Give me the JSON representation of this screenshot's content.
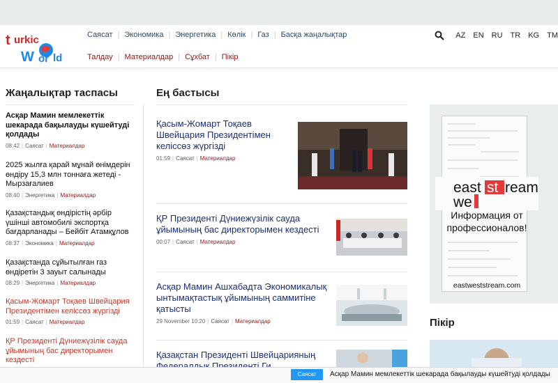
{
  "logo": {
    "text": "turkic world"
  },
  "nav_primary": [
    "Саясат",
    "Экономика",
    "Энергетика",
    "Көлік",
    "Газ",
    "Басқа жаңалықтар"
  ],
  "nav_secondary": [
    "Талдау",
    "Материалдар",
    "Сұхбат",
    "Пікір"
  ],
  "languages": [
    "AZ",
    "EN",
    "RU",
    "TR",
    "KG",
    "TM"
  ],
  "feed": {
    "title": "Жаңалықтар таспасы",
    "items": [
      {
        "title": "Асқар Мамин мемлекеттік шекарада бақылауды күшейтуді қолдады",
        "time": "08:42",
        "category": "Саясат",
        "type": "Материалдар"
      },
      {
        "title": "2025 жылға қарай мұнай өнімдерін өндіру 15,3 млн тоннаға жетеді - Мырзағалиев",
        "time": "08:40",
        "category": "Энергетика",
        "type": "Материалдар"
      },
      {
        "title": "Қазақстандық өндірістің әрбір үшінші автомобилі экспортқа бағдарланады – Бейбіт Атамқұлов",
        "time": "08:37",
        "category": "Экономика",
        "type": "Материалдар"
      },
      {
        "title": "Қазақстанда сұйытылған газ өндіретін 3 зауыт салынады",
        "time": "08:29",
        "category": "Энергетика",
        "type": "Материалдар"
      },
      {
        "title": "Қасым-Жомарт Тоқаев Швейцария Президентімен келіссөз жүргізді",
        "time": "01:59",
        "category": "Саясат",
        "type": "Материалдар"
      },
      {
        "title": "ҚР Президенті Дүниежүзілік сауда ұйымының бас директорымен кездесті",
        "time": "",
        "category": "",
        "type": ""
      }
    ]
  },
  "top": {
    "title": "Ең бастысы",
    "stories": [
      {
        "title": "Қасым-Жомарт Тоқаев Швейцария Президентімен келіссөз жүргізді",
        "time": "01:59",
        "category": "Саясат",
        "type": "Материалдар"
      },
      {
        "title": "ҚР Президенті Дүниежүзілік сауда ұйымының бас директорымен кездесті",
        "time": "00:07",
        "category": "Саясат",
        "type": "Материалдар"
      },
      {
        "title": "Асқар Мамин Ашхабадта Экономикалық ынтымақтастық ұйымының саммитіне қатысты",
        "time": "29 November 10:20",
        "category": "Саясат",
        "type": "Материалдар"
      },
      {
        "title": "Қазақстан Президенті Швейцарияның Федералдық Президенті Ги",
        "time": "",
        "category": "",
        "type": ""
      }
    ]
  },
  "ad": {
    "brand_top": "east",
    "brand_mid": "st",
    "brand_bottom_left": "we",
    "brand_bottom_right": "ream",
    "text": "Информация от профессионалов!",
    "url": "eastweststream.com"
  },
  "opinion": {
    "title": "Пікір"
  },
  "ticker": {
    "button": "Саясат",
    "text": "Асқар Мамин мемлекеттік шекарада бақылауды күшейтуді қолдады"
  }
}
